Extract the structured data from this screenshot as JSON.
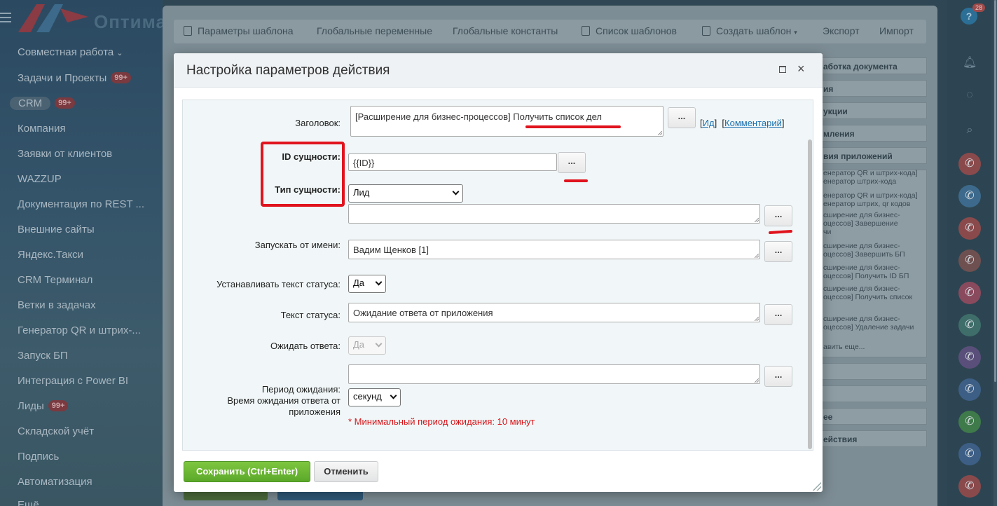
{
  "sidebar": {
    "logo_text": "Оптима",
    "items": [
      {
        "label": "Совместная работа",
        "chevron": true
      },
      {
        "label": "Задачи и Проекты",
        "badge": "99+"
      },
      {
        "label": "CRM",
        "badge": "99+",
        "active": true
      },
      {
        "label": "Компания"
      },
      {
        "label": "Заявки от клиентов"
      },
      {
        "label": "WAZZUP"
      },
      {
        "label": "Документация по REST ..."
      },
      {
        "label": "Внешние сайты"
      },
      {
        "label": "Яндекс.Такси"
      },
      {
        "label": "CRM Терминал"
      },
      {
        "label": "Ветки в задачах"
      },
      {
        "label": "Генератор QR и штрих-..."
      },
      {
        "label": "Запуск БП"
      },
      {
        "label": "Интеграция с Power BI"
      },
      {
        "label": "Лиды",
        "badge": "99+"
      },
      {
        "label": "Складской учёт"
      },
      {
        "label": "Подпись"
      },
      {
        "label": "Автоматизация"
      },
      {
        "label": "Ещё"
      }
    ]
  },
  "background": {
    "tabs": [
      {
        "label": "Параметры шаблона",
        "icon": "template-icon"
      },
      {
        "label": "Глобальные переменные"
      },
      {
        "label": "Глобальные константы"
      },
      {
        "label": "Список шаблонов",
        "icon": "list-icon"
      },
      {
        "label": "Создать шаблон",
        "icon": "create-icon",
        "dropdown": true
      },
      {
        "label": "Экспорт"
      },
      {
        "label": "Импорт"
      }
    ],
    "right_sections": [
      "аботка документа",
      "ия",
      "укции",
      "мления",
      "вия приложений"
    ],
    "right_list_items": [
      "енератор QR и штрих-кода]\nенератор штрих-кода",
      "енератор QR и штрих-кода]\nенератор штрих, qr кодов",
      "сширение для бизнес-\nоцессов] Завершение\nчи",
      "сширение для бизнес-\nоцессов] Завершить БП",
      "сширение для бизнес-\nоцессов] Получить ID БП",
      "сширение для бизнес-\nоцессов] Получить список",
      "сширение для бизнес-\nоцессов] Удаление задачи",
      "авить еще..."
    ],
    "right_sections_bottom": [
      "",
      "",
      "ее",
      "ействия"
    ]
  },
  "rail": {
    "help_badge": "28",
    "help_icon": "question-icon"
  },
  "dialog": {
    "title": "Настройка параметров действия",
    "fields": {
      "title_label": "Заголовок:",
      "title_value": "[Расширение для бизнес-процессов] Получить список дел",
      "title_links": {
        "id": "Ид",
        "comment": "Комментарий"
      },
      "entity_id_label": "ID сущности:",
      "entity_id_value": "{{ID}}",
      "entity_type_label": "Тип сущности:",
      "entity_type_value": "Лид",
      "run_as_label": "Запускать от имени:",
      "run_as_value": "Вадим Щенков [1]",
      "set_status_label": "Устанавливать текст статуса:",
      "set_status_value": "Да",
      "status_text_label": "Текст статуса:",
      "status_text_value": "Ожидание ответа от приложения",
      "wait_label": "Ожидать ответа:",
      "wait_value": "Да",
      "period_label_1": "Период ожидания:",
      "period_label_2": "Время ожидания ответа от",
      "period_label_3": "приложения",
      "period_unit": "секунд",
      "min_period_note": "* Минимальный период ожидания: 10 минут"
    },
    "dots_label": "...",
    "save_label": "Сохранить (Ctrl+Enter)",
    "cancel_label": "Отменить",
    "close_glyph": "×"
  },
  "colors": {
    "annotation_red": "#e0141e",
    "save_green": "#6cb935",
    "link_blue": "#1a6fae",
    "warning_red": "#d6141a"
  }
}
